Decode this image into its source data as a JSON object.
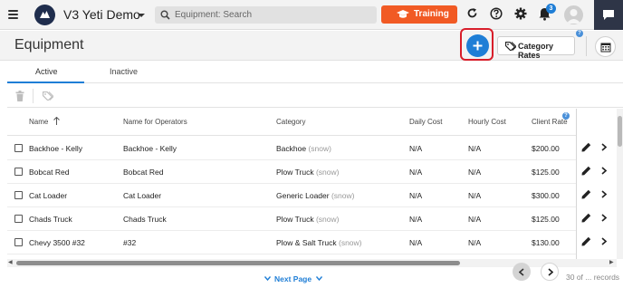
{
  "app": {
    "name": "V3 Yeti Demo"
  },
  "search": {
    "placeholder": "Equipment: Search"
  },
  "training_label": "Training",
  "notifications": {
    "count": "3"
  },
  "page": {
    "title": "Equipment",
    "category_rates_label": "Category Rates"
  },
  "tabs": [
    {
      "label": "Active",
      "active": true
    },
    {
      "label": "Inactive",
      "active": false
    }
  ],
  "table": {
    "columns": [
      "Name",
      "Name for Operators",
      "Category",
      "Daily Cost",
      "Hourly Cost",
      "Client Rate"
    ],
    "rows": [
      {
        "name": "Backhoe - Kelly",
        "operator_name": "Backhoe - Kelly",
        "category": "Backhoe",
        "category_tag": "(snow)",
        "daily": "N/A",
        "hourly": "N/A",
        "client_rate": "$200.00"
      },
      {
        "name": "Bobcat Red",
        "operator_name": "Bobcat Red",
        "category": "Plow Truck",
        "category_tag": "(snow)",
        "daily": "N/A",
        "hourly": "N/A",
        "client_rate": "$125.00"
      },
      {
        "name": "Cat Loader",
        "operator_name": "Cat Loader",
        "category": "Generic Loader",
        "category_tag": "(snow)",
        "daily": "N/A",
        "hourly": "N/A",
        "client_rate": "$300.00"
      },
      {
        "name": "Chads Truck",
        "operator_name": "Chads Truck",
        "category": "Plow Truck",
        "category_tag": "(snow)",
        "daily": "N/A",
        "hourly": "N/A",
        "client_rate": "$125.00"
      },
      {
        "name": "Chevy 3500 #32",
        "operator_name": "#32",
        "category": "Plow & Salt Truck",
        "category_tag": "(snow)",
        "daily": "N/A",
        "hourly": "N/A",
        "client_rate": "$130.00"
      }
    ]
  },
  "pagination": {
    "next_label": "Next Page",
    "records_label": "30 of ... records"
  },
  "colors": {
    "accent": "#1f7ed6",
    "training": "#f15a24",
    "highlight": "#d81e2a",
    "dark": "#2e3547"
  },
  "icons": [
    "hamburger-icon",
    "yeti-logo-icon",
    "search-icon",
    "graduation-cap-icon",
    "refresh-icon",
    "help-icon",
    "gear-icon",
    "bell-icon",
    "avatar-icon",
    "chat-icon",
    "plus-icon",
    "tags-icon",
    "calendar-icon",
    "trash-icon",
    "sort-up-icon",
    "pencil-icon",
    "chevron-right-icon",
    "chevron-left-icon",
    "chevron-down-icon"
  ]
}
